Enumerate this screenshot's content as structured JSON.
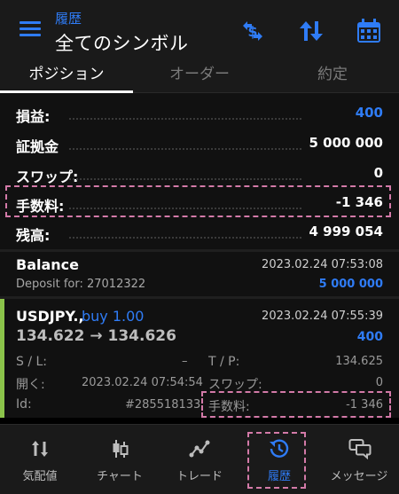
{
  "header": {
    "subtitle": "履歴",
    "title": "全てのシンボル",
    "icons": [
      "menu-icon",
      "currency-icon",
      "sort-icon",
      "calendar-icon"
    ],
    "accent_color": "#2f7cf6"
  },
  "tabs": [
    {
      "label": "ポジション",
      "active": true
    },
    {
      "label": "オーダー",
      "active": false
    },
    {
      "label": "約定",
      "active": false
    }
  ],
  "summary": {
    "profit": {
      "label": "損益:",
      "value": "400"
    },
    "deposit": {
      "label": "証拠金",
      "value": "5 000 000"
    },
    "swap": {
      "label": "スワップ:",
      "value": "0"
    },
    "commission": {
      "label": "手数料:",
      "value": "-1 346"
    },
    "balance": {
      "label": "残高:",
      "value": "4 999 054"
    }
  },
  "deal": {
    "name": "Balance",
    "time": "2023.02.24 07:53:08",
    "comment": "Deposit for: 27012322",
    "amount": "5 000 000"
  },
  "position": {
    "symbol": "USDJPY.,",
    "side": "buy 1.00",
    "time": "2023.02.24 07:55:39",
    "prices": "134.622 → 134.626",
    "profit": "400",
    "sl_label": "S / L:",
    "sl_value": "–",
    "tp_label": "T / P:",
    "tp_value": "134.625",
    "open_label": "開く:",
    "open_value": "2023.02.24 07:54:54",
    "swap_label": "スワップ:",
    "swap_value": "0",
    "id_label": "Id:",
    "id_value": "#285518133",
    "commission_label": "手数料:",
    "commission_value": "-1 346",
    "accent_color": "#8bc34a"
  },
  "bottom_nav": [
    {
      "label": "気配値",
      "icon": "quotes-icon",
      "active": false
    },
    {
      "label": "チャート",
      "icon": "chart-icon",
      "active": false
    },
    {
      "label": "トレード",
      "icon": "trade-icon",
      "active": false
    },
    {
      "label": "履歴",
      "icon": "history-icon",
      "active": true
    },
    {
      "label": "メッセージ",
      "icon": "messages-icon",
      "active": false
    }
  ]
}
